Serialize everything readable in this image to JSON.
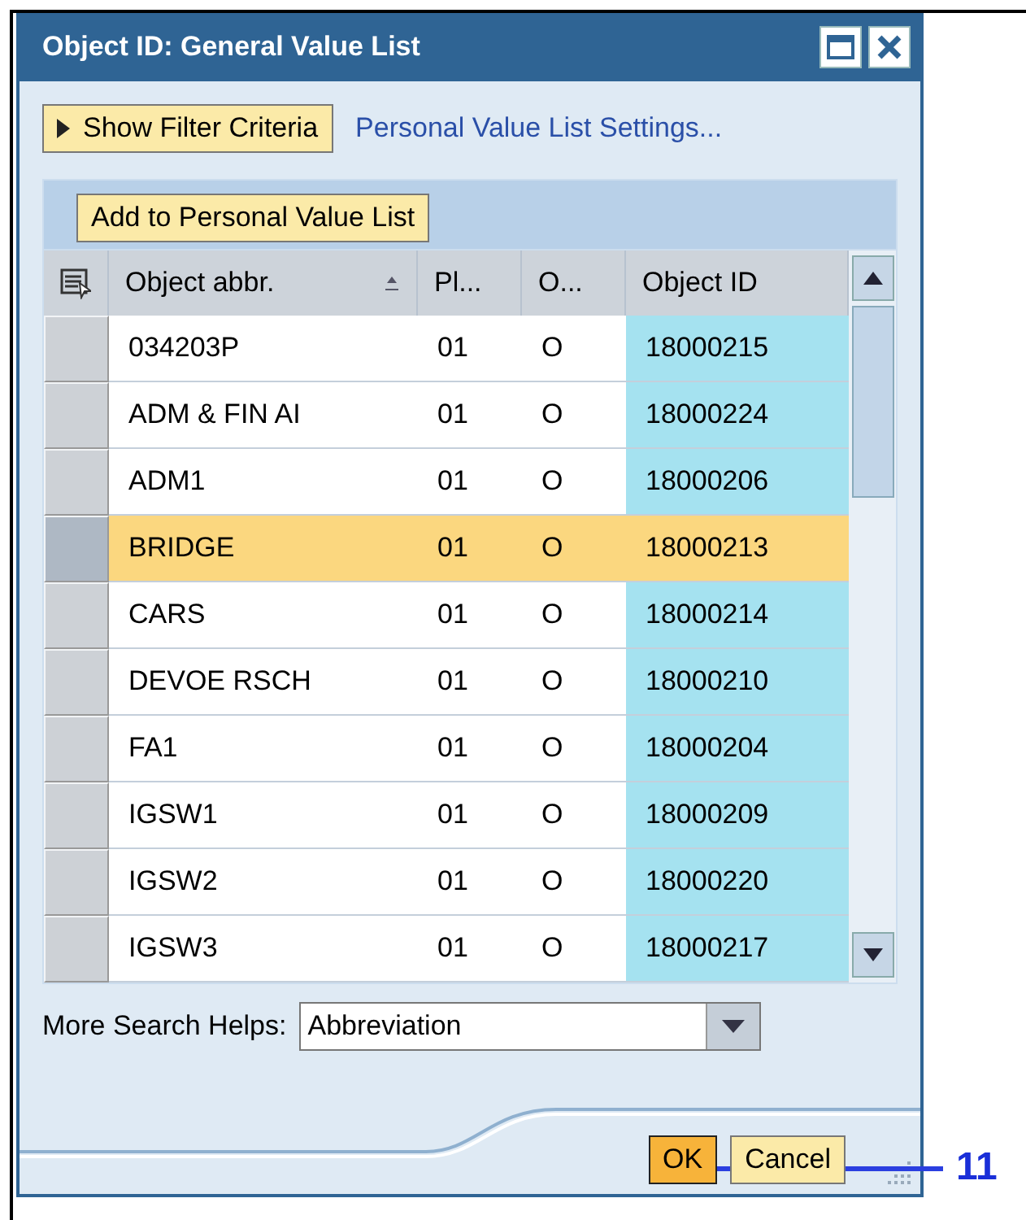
{
  "window": {
    "title": "Object ID: General Value List"
  },
  "filter_button": "Show Filter Criteria",
  "settings_link": "Personal Value List Settings...",
  "toolbar": {
    "button": "Add to Personal Value List"
  },
  "table": {
    "columns": [
      {
        "label": "Object abbr.",
        "sorted": true
      },
      {
        "label": "Pl...",
        "sorted": false
      },
      {
        "label": "O...",
        "sorted": false
      },
      {
        "label": "Object ID",
        "sorted": false
      }
    ],
    "rows": [
      {
        "cells": [
          "034203P",
          "01",
          "O",
          "18000215"
        ],
        "selected": false
      },
      {
        "cells": [
          "ADM & FIN AI",
          "01",
          "O",
          "18000224"
        ],
        "selected": false
      },
      {
        "cells": [
          "ADM1",
          "01",
          "O",
          "18000206"
        ],
        "selected": false
      },
      {
        "cells": [
          "BRIDGE",
          "01",
          "O",
          "18000213"
        ],
        "selected": true
      },
      {
        "cells": [
          "CARS",
          "01",
          "O",
          "18000214"
        ],
        "selected": false
      },
      {
        "cells": [
          "DEVOE RSCH",
          "01",
          "O",
          "18000210"
        ],
        "selected": false
      },
      {
        "cells": [
          "FA1",
          "01",
          "O",
          "18000204"
        ],
        "selected": false
      },
      {
        "cells": [
          "IGSW1",
          "01",
          "O",
          "18000209"
        ],
        "selected": false
      },
      {
        "cells": [
          "IGSW2",
          "01",
          "O",
          "18000220"
        ],
        "selected": false
      },
      {
        "cells": [
          "IGSW3",
          "01",
          "O",
          "18000217"
        ],
        "selected": false
      }
    ]
  },
  "search_helps": {
    "label": "More Search Helps:",
    "value": "Abbreviation"
  },
  "buttons": [
    {
      "label": "OK",
      "kind": "primary"
    },
    {
      "label": "Cancel",
      "kind": "secondary"
    }
  ],
  "callout": "11"
}
